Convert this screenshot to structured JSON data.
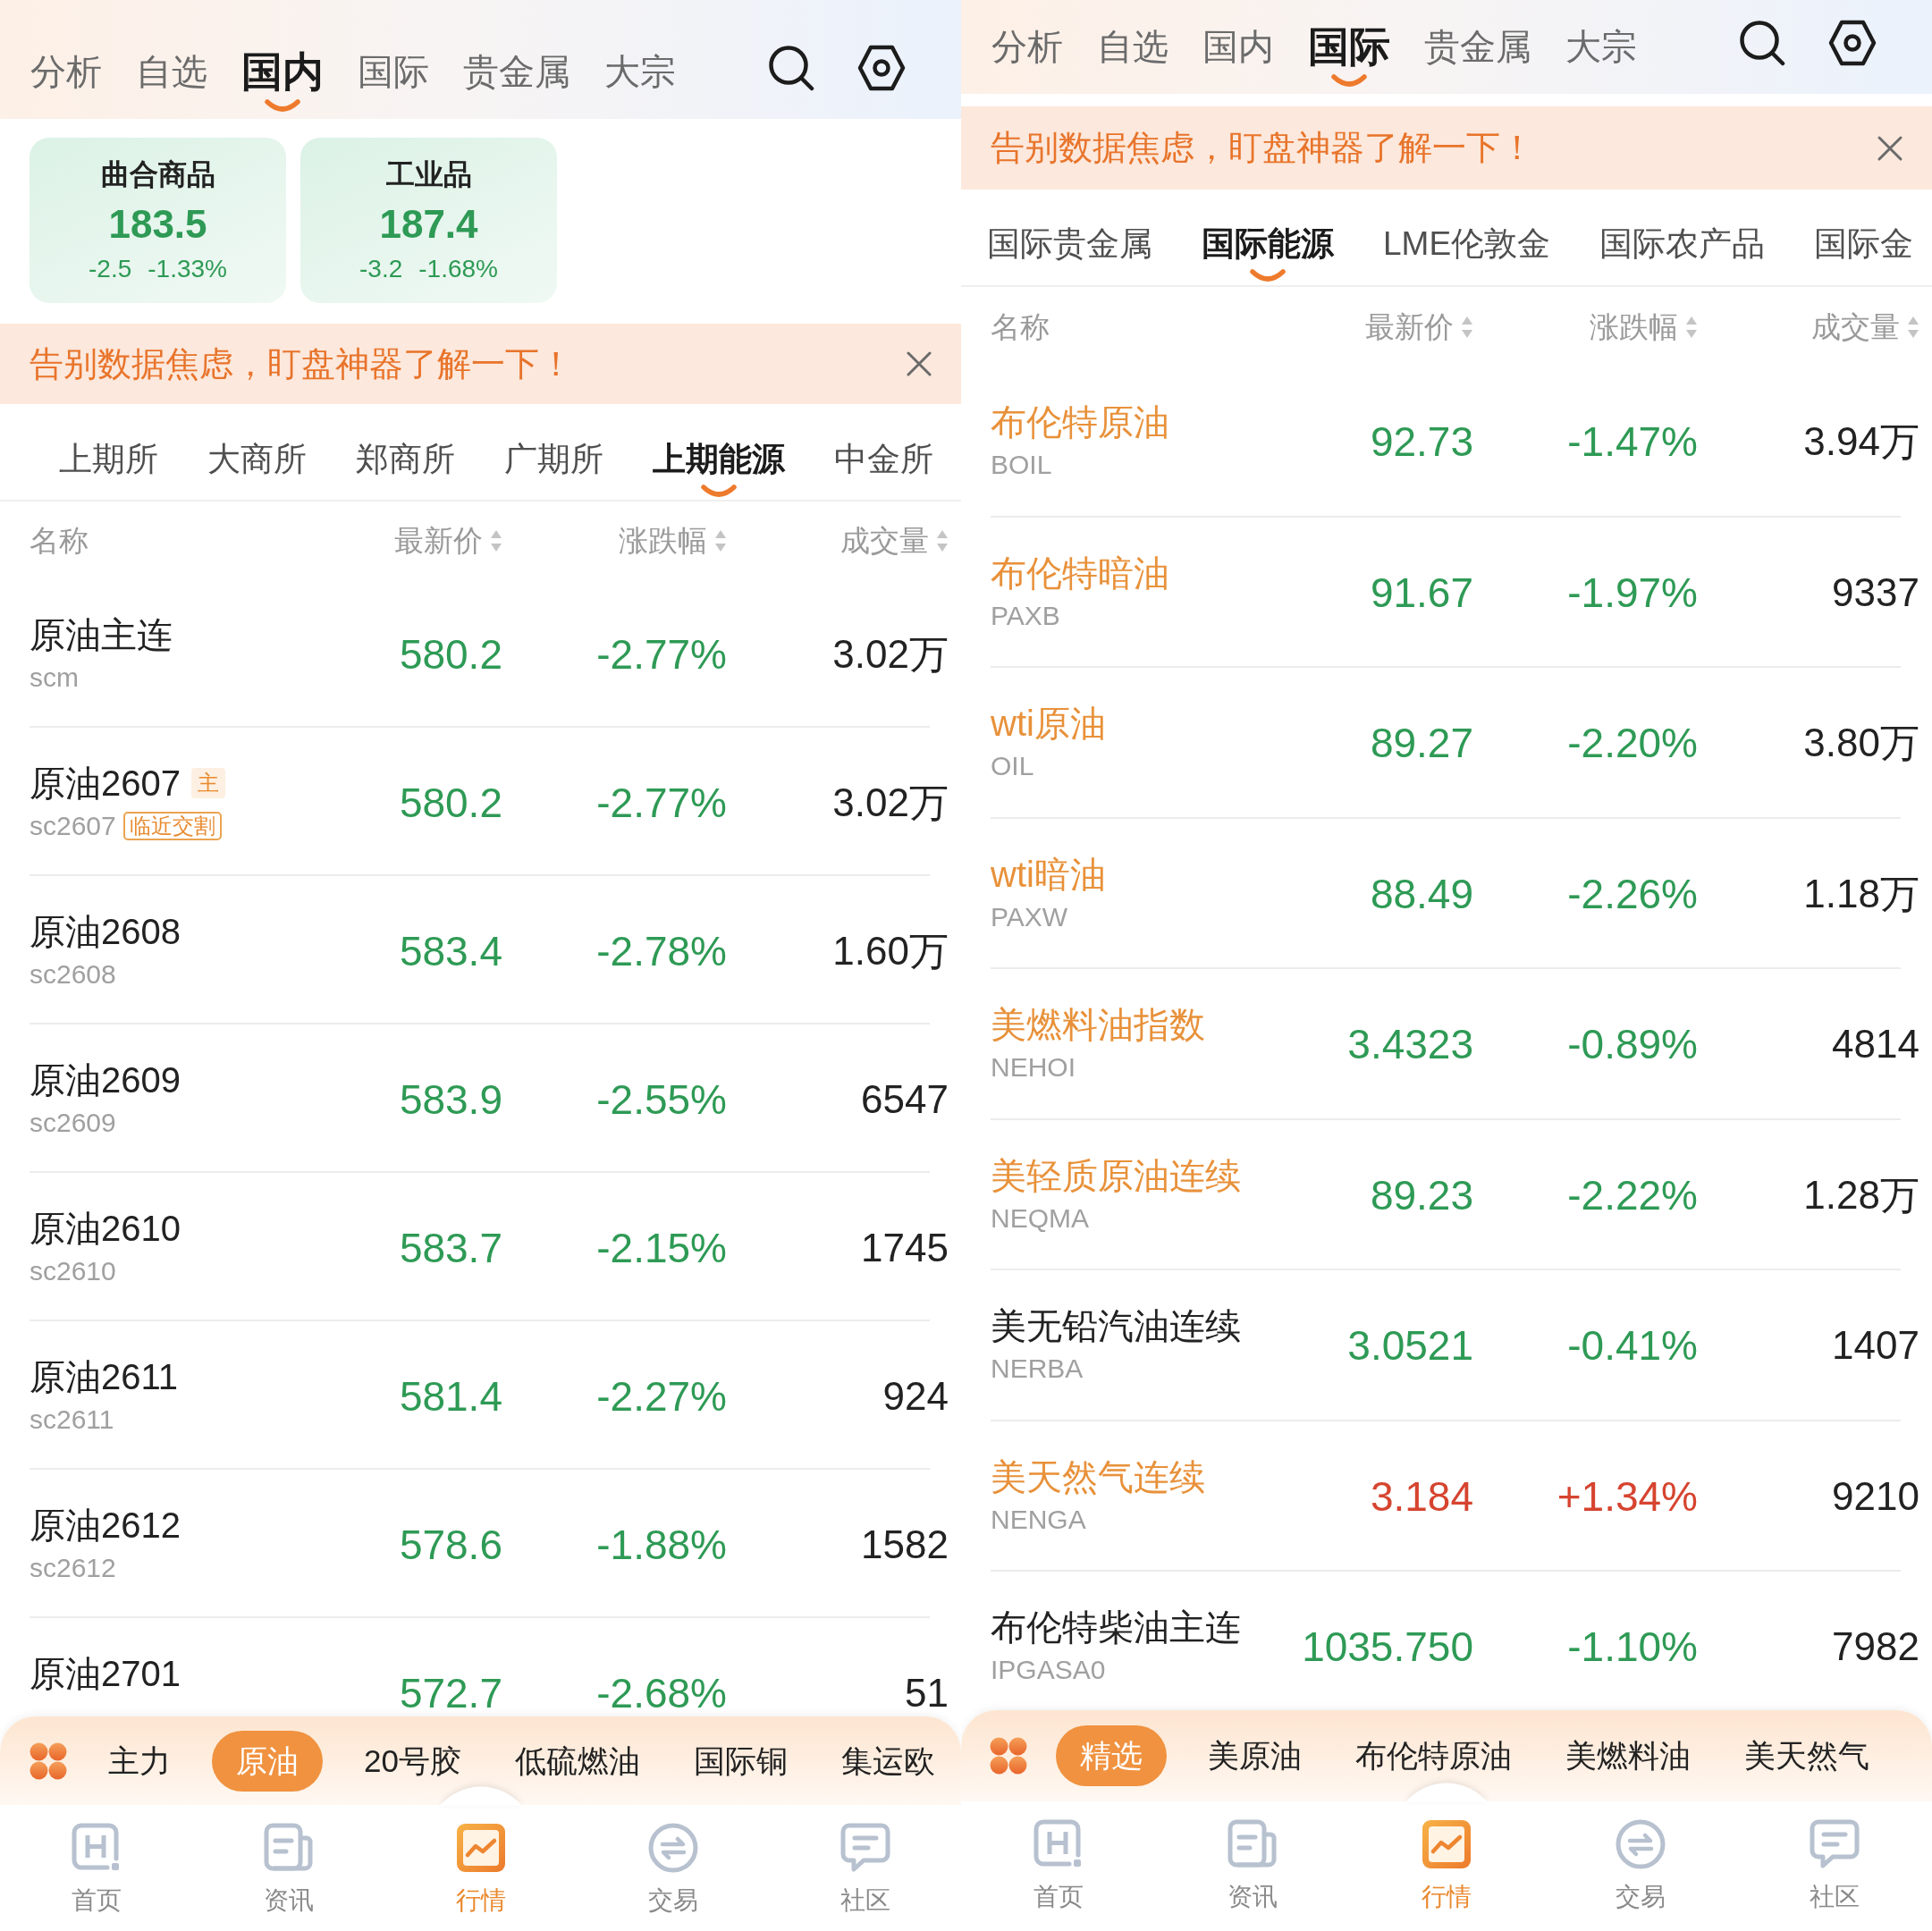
{
  "panels": [
    {
      "top_tabs": [
        {
          "label": "分析",
          "selected": false
        },
        {
          "label": "自选",
          "selected": false
        },
        {
          "label": "国内",
          "selected": true
        },
        {
          "label": "国际",
          "selected": false
        },
        {
          "label": "贵金属",
          "selected": false
        },
        {
          "label": "大宗",
          "selected": false
        }
      ],
      "index_cards": [
        {
          "title": "曲合商品",
          "value": "183.5",
          "change": "-2.5",
          "change_pct": "-1.33%",
          "rising": false
        },
        {
          "title": "工业品",
          "value": "187.4",
          "change": "-3.2",
          "change_pct": "-1.68%",
          "rising": false
        }
      ],
      "banner": {
        "text": "告别数据焦虑，盯盘神器了解一下！"
      },
      "sub_tabs": [
        {
          "label": "上期所",
          "selected": false
        },
        {
          "label": "大商所",
          "selected": false
        },
        {
          "label": "郑商所",
          "selected": false
        },
        {
          "label": "广期所",
          "selected": false
        },
        {
          "label": "上期能源",
          "selected": true
        },
        {
          "label": "中金所",
          "selected": false
        }
      ],
      "table": {
        "columns": [
          {
            "label": "名称",
            "sortable": false
          },
          {
            "label": "最新价",
            "sortable": true
          },
          {
            "label": "涨跌幅",
            "sortable": true
          },
          {
            "label": "成交量",
            "sortable": true
          }
        ],
        "rows": [
          {
            "name": "原油主连",
            "code": "scm",
            "price": "580.2",
            "change": "-2.77%",
            "volume": "3.02万",
            "rising": false
          },
          {
            "name": "原油2607",
            "name_badge": "主",
            "code": "sc2607",
            "code_badge": "临近交割",
            "price": "580.2",
            "change": "-2.77%",
            "volume": "3.02万",
            "rising": false
          },
          {
            "name": "原油2608",
            "code": "sc2608",
            "price": "583.4",
            "change": "-2.78%",
            "volume": "1.60万",
            "rising": false
          },
          {
            "name": "原油2609",
            "code": "sc2609",
            "price": "583.9",
            "change": "-2.55%",
            "volume": "6547",
            "rising": false
          },
          {
            "name": "原油2610",
            "code": "sc2610",
            "price": "583.7",
            "change": "-2.15%",
            "volume": "1745",
            "rising": false
          },
          {
            "name": "原油2611",
            "code": "sc2611",
            "price": "581.4",
            "change": "-2.27%",
            "volume": "924",
            "rising": false
          },
          {
            "name": "原油2612",
            "code": "sc2612",
            "price": "578.6",
            "change": "-1.88%",
            "volume": "1582",
            "rising": false
          },
          {
            "name": "原油2701",
            "price": "572.7",
            "change": "-2.68%",
            "volume": "51",
            "rising": false
          }
        ]
      },
      "chips": [
        {
          "label": "主力",
          "selected": false
        },
        {
          "label": "原油",
          "selected": true
        },
        {
          "label": "20号胶",
          "selected": false
        },
        {
          "label": "低硫燃油",
          "selected": false
        },
        {
          "label": "国际铜",
          "selected": false
        },
        {
          "label": "集运欧",
          "selected": false
        }
      ],
      "tab_bar": [
        {
          "label": "首页",
          "selected": false
        },
        {
          "label": "资讯",
          "selected": false
        },
        {
          "label": "行情",
          "selected": true
        },
        {
          "label": "交易",
          "selected": false
        },
        {
          "label": "社区",
          "selected": false
        }
      ]
    },
    {
      "top_tabs": [
        {
          "label": "分析",
          "selected": false
        },
        {
          "label": "自选",
          "selected": false
        },
        {
          "label": "国内",
          "selected": false
        },
        {
          "label": "国际",
          "selected": true
        },
        {
          "label": "贵金属",
          "selected": false
        },
        {
          "label": "大宗",
          "selected": false
        }
      ],
      "banner": {
        "text": "告别数据焦虑，盯盘神器了解一下！"
      },
      "sub_tabs": [
        {
          "label": "国际贵金属",
          "selected": false
        },
        {
          "label": "国际能源",
          "selected": true
        },
        {
          "label": "LME伦敦金",
          "selected": false
        },
        {
          "label": "国际农产品",
          "selected": false
        },
        {
          "label": "国际金",
          "selected": false
        }
      ],
      "table": {
        "columns": [
          {
            "label": "名称",
            "sortable": false
          },
          {
            "label": "最新价",
            "sortable": true
          },
          {
            "label": "涨跌幅",
            "sortable": true
          },
          {
            "label": "成交量",
            "sortable": true
          }
        ],
        "rows": [
          {
            "name": "布伦特原油",
            "highlighted": true,
            "code": "BOIL",
            "price": "92.73",
            "change": "-1.47%",
            "volume": "3.94万",
            "rising": false
          },
          {
            "name": "布伦特暗油",
            "highlighted": true,
            "code": "PAXB",
            "price": "91.67",
            "change": "-1.97%",
            "volume": "9337",
            "rising": false
          },
          {
            "name": "wti原油",
            "highlighted": true,
            "code": "OIL",
            "price": "89.27",
            "change": "-2.20%",
            "volume": "3.80万",
            "rising": false
          },
          {
            "name": "wti暗油",
            "highlighted": true,
            "code": "PAXW",
            "price": "88.49",
            "change": "-2.26%",
            "volume": "1.18万",
            "rising": false
          },
          {
            "name": "美燃料油指数",
            "highlighted": true,
            "code": "NEHOI",
            "price": "3.4323",
            "change": "-0.89%",
            "volume": "4814",
            "rising": false
          },
          {
            "name": "美轻质原油连续",
            "highlighted": true,
            "code": "NEQMA",
            "price": "89.23",
            "change": "-2.22%",
            "volume": "1.28万",
            "rising": false
          },
          {
            "name": "美无铅汽油连续",
            "highlighted": false,
            "code": "NERBA",
            "price": "3.0521",
            "change": "-0.41%",
            "volume": "1407",
            "rising": false
          },
          {
            "name": "美天然气连续",
            "highlighted": true,
            "code": "NENGA",
            "price": "3.184",
            "change": "+1.34%",
            "volume": "9210",
            "rising": true
          },
          {
            "name": "布伦特柴油主连",
            "highlighted": false,
            "code": "IPGASA0",
            "price": "1035.750",
            "change": "-1.10%",
            "volume": "7982",
            "rising": false
          }
        ]
      },
      "chips": [
        {
          "label": "精选",
          "selected": true
        },
        {
          "label": "美原油",
          "selected": false
        },
        {
          "label": "布伦特原油",
          "selected": false
        },
        {
          "label": "美燃料油",
          "selected": false
        },
        {
          "label": "美天然气",
          "selected": false
        }
      ],
      "tab_bar": [
        {
          "label": "首页",
          "selected": false
        },
        {
          "label": "资讯",
          "selected": false
        },
        {
          "label": "行情",
          "selected": true
        },
        {
          "label": "交易",
          "selected": false
        },
        {
          "label": "社区",
          "selected": false
        }
      ]
    }
  ]
}
